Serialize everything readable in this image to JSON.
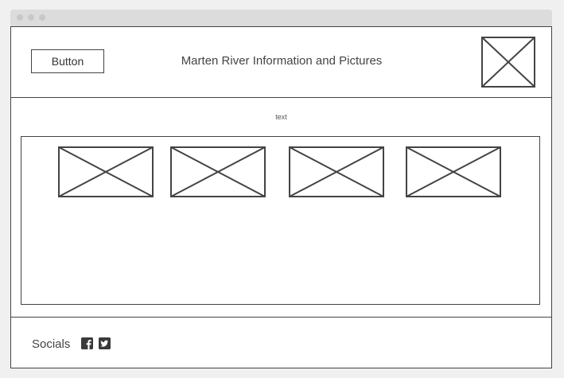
{
  "header": {
    "button_label": "Button",
    "title": "Marten River Information and Pictures",
    "logo_icon": "image-placeholder-icon"
  },
  "main": {
    "text": "text",
    "gallery": [
      {
        "icon": "image-placeholder-icon"
      },
      {
        "icon": "image-placeholder-icon"
      },
      {
        "icon": "image-placeholder-icon"
      },
      {
        "icon": "image-placeholder-icon"
      }
    ]
  },
  "footer": {
    "socials_label": "Socials",
    "icons": [
      "facebook-icon",
      "twitter-icon"
    ]
  },
  "colors": {
    "stroke": "#444444",
    "background": "#f0f0f0",
    "titlebar": "#dcdcdc"
  }
}
